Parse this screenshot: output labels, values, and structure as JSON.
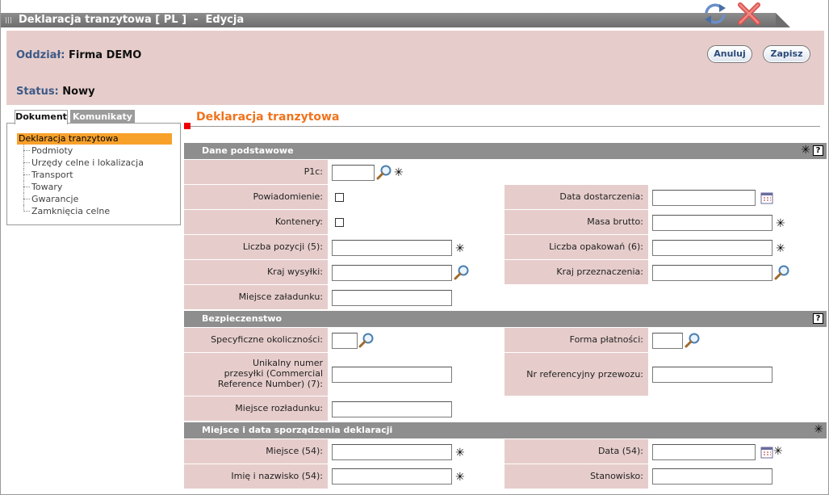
{
  "window": {
    "title": "Deklaracja tranzytowa [ PL ]  -  Edycja"
  },
  "header": {
    "oddzial_label": "Oddział:",
    "oddzial_value": "Firma DEMO",
    "status_label": "Status:",
    "status_value": "Nowy",
    "cancel_label": "Anuluj",
    "save_label": "Zapisz"
  },
  "tabs": {
    "dokument": "Dokument",
    "komunikaty": "Komunikaty"
  },
  "tree": {
    "root": "Deklaracja tranzytowa",
    "items": [
      "Podmioty",
      "Urzędy celne i lokalizacja",
      "Transport",
      "Towary",
      "Gwarancje",
      "Zamknięcia celne"
    ]
  },
  "main": {
    "title": "Deklaracja tranzytowa"
  },
  "sections": {
    "dane": "Dane podstawowe",
    "bezp": "Bezpieczenstwo",
    "miejsce": "Miejsce i data sporządzenia deklaracji"
  },
  "fields": {
    "p1c": "P1c:",
    "powiadomienie": "Powiadomienie:",
    "data_dostarczenia": "Data dostarczenia:",
    "kontenery": "Kontenery:",
    "masa_brutto": "Masa brutto:",
    "liczba_pozycji": "Liczba pozycji (5):",
    "liczba_opakowan": "Liczba opakowań (6):",
    "kraj_wysylki": "Kraj wysyłki:",
    "kraj_przeznaczenia": "Kraj przeznaczenia:",
    "miejsce_zaladunku": "Miejsce załadunku:",
    "specyficzne": "Specyficzne okoliczności:",
    "forma_platnosci": "Forma płatności:",
    "unikalny": "Unikalny numer przesyłki (Commercial Reference Number) (7):",
    "nr_ref": "Nr referencyjny przewozu:",
    "miejsce_rozladunku": "Miejsce rozładunku:",
    "miejsce": "Miejsce (54):",
    "data": "Data (54):",
    "imie": "Imię i nazwisko (54):",
    "stanowisko": "Stanowisko:"
  },
  "values": {
    "p1c": "",
    "data_dostarczenia": "",
    "masa_brutto": "",
    "liczba_pozycji": "",
    "liczba_opakowan": "",
    "kraj_wysylki": "",
    "kraj_przeznaczenia": "",
    "miejsce_zaladunku": "",
    "specyficzne": "",
    "forma_platnosci": "",
    "unikalny": "",
    "nr_ref": "",
    "miejsce_rozladunku": "",
    "miejsce": "",
    "data": "",
    "imie": "",
    "stanowisko": ""
  },
  "symbols": {
    "required": "✳",
    "help": "?"
  },
  "icons": {
    "refresh": "refresh-icon",
    "close": "close-icon",
    "search": "magnifier-icon",
    "calendar": "calendar-icon",
    "checkbox": "checkbox"
  },
  "colors": {
    "accent": "#f0731c",
    "header_bg": "#e6cdcb",
    "section_bg": "#8e8e8e",
    "selected_tree": "#f7a12b",
    "label_blue": "#3d5a87"
  }
}
